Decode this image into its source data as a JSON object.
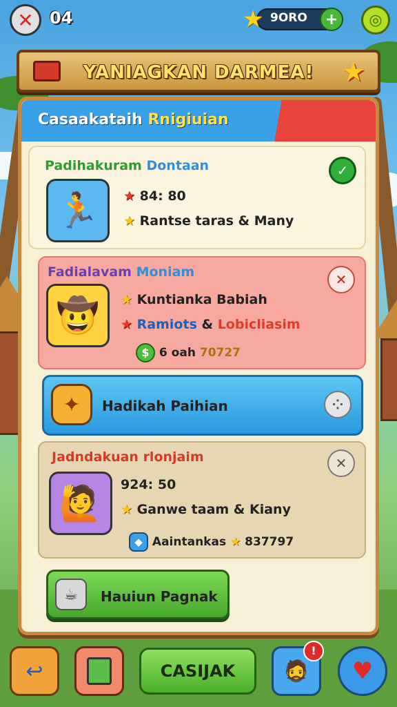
{
  "topbar": {
    "close_icon": "close-icon",
    "level": "04",
    "coins": "9ORO",
    "plus_icon": "plus-icon",
    "settings_icon": "settings-icon"
  },
  "banner": {
    "title": "YANIAGKAN DARMEA!"
  },
  "panel": {
    "header_part1": "Casaakataih ",
    "header_part2": "Rnigiuian"
  },
  "cards": [
    {
      "title_a": "Padihakuram ",
      "title_b": "Dontaan",
      "line1": "84: 80",
      "line2": "Rantse taras & Many",
      "status": "✓",
      "colors": {
        "bg": "#fbf4df",
        "a": "#2e9c2e",
        "b": "#2f8fd8"
      }
    },
    {
      "title_a": "Fadialavam ",
      "title_b": "Moniam",
      "line1": "Kuntianka Babiah",
      "line2_a": "Ramiots ",
      "line2_b": "& ",
      "line2_c": "Lobicliasim",
      "coin_label": "6 oah",
      "coin_value": "70727",
      "status": "✕",
      "colors": {
        "bg": "#f7a8a0",
        "a": "#6a3fb0",
        "b": "#2f8fd8"
      }
    },
    {
      "label": "Hadikah Paihian",
      "colors": {
        "bg": "#3db0ea"
      }
    },
    {
      "title": "Jadndakuan rlonjaim",
      "line1": "924: 50",
      "line2": "Ganwe taam & Kiany",
      "line3_a": "Aaintankas ",
      "line3_b": "837797",
      "status": "✕",
      "colors": {
        "bg": "#e6d6b4",
        "a": "#d23a2a"
      }
    }
  ],
  "action_button": {
    "label": "Hauiun Pagnak"
  },
  "bottom_nav": {
    "back_icon": "back-arrow-icon",
    "map_icon": "map-icon",
    "main_label": "CASIJAK",
    "profile_badge": "!",
    "heart_icon": "heart-icon"
  }
}
